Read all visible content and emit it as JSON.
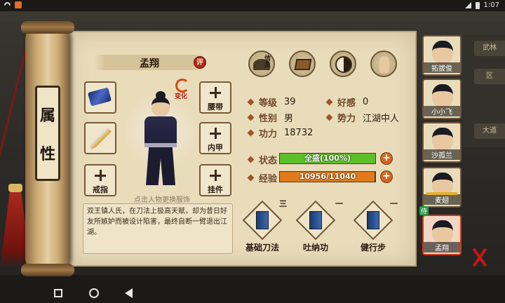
{
  "status_bar": {
    "time": "1:07"
  },
  "background": {
    "right_tags": [
      "武林",
      "区",
      "大道"
    ]
  },
  "scroll": {
    "title_chars": [
      "属",
      "性"
    ]
  },
  "character": {
    "name": "孟翔",
    "rating_badge": "评",
    "transform_label": "变化",
    "change_hint": "点击人物更换服饰",
    "bio": "双王镇人氏，在刀法上极高天赋，却为昔日好友所嫉妒而被设计陷害，最终自断一臂退出江湖。"
  },
  "equipment": {
    "left": [
      {
        "label": "",
        "item": "armor"
      },
      {
        "label": "",
        "item": "weapon"
      },
      {
        "label": "戒指",
        "item": ""
      }
    ],
    "right": [
      {
        "label": "腰带"
      },
      {
        "label": "内甲"
      },
      {
        "label": "挂件"
      }
    ]
  },
  "top_icons": [
    {
      "name": "hat-icon",
      "tag": "信息"
    },
    {
      "name": "chest-icon",
      "tag": ""
    },
    {
      "name": "bagua-icon",
      "tag": ""
    },
    {
      "name": "meridian-icon",
      "tag": ""
    }
  ],
  "stats": {
    "level_label": "等级",
    "level": "39",
    "favor_label": "好感",
    "favor": "0",
    "gender_label": "性别",
    "gender": "男",
    "faction_label": "势力",
    "faction": "江湖中人",
    "power_label": "功力",
    "power": "18732"
  },
  "bars": {
    "state_label": "状态",
    "state_text": "全盛(100%)",
    "state_fraction": 1.0,
    "state_color": "#5cc02a",
    "exp_label": "经验",
    "exp_text": "10956/11040",
    "exp_fraction": 0.992,
    "exp_color": "#e07a1a"
  },
  "skills": [
    {
      "name": "基础刀法",
      "level": "三"
    },
    {
      "name": "吐纳功",
      "level": "一"
    },
    {
      "name": "健行步",
      "level": "一"
    }
  ],
  "party": [
    {
      "name": "拓拔俊"
    },
    {
      "name": "小小飞"
    },
    {
      "name": "沙孤兰"
    },
    {
      "name": "麦翅"
    },
    {
      "name": "孟翔"
    }
  ],
  "party_badge": "侍"
}
